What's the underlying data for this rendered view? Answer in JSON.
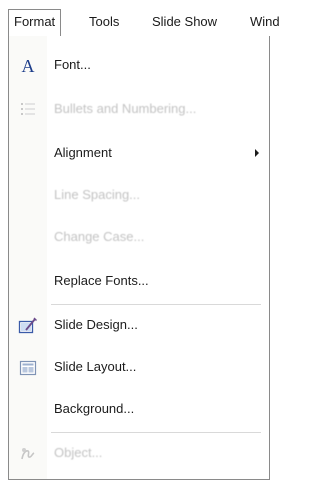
{
  "menubar": {
    "items": [
      "Format",
      "Tools",
      "Slide Show",
      "Wind"
    ]
  },
  "menu": {
    "items": [
      {
        "label": "Font...",
        "enabled": true,
        "icon": "font-a-icon"
      },
      {
        "label": "Bullets and Numbering...",
        "enabled": false,
        "icon": "bullets-icon"
      },
      {
        "label": "Alignment",
        "enabled": true,
        "submenu": true
      },
      {
        "label": "Line Spacing...",
        "enabled": false
      },
      {
        "label": "Change Case...",
        "enabled": false
      },
      {
        "label": "Replace Fonts...",
        "enabled": true
      },
      {
        "label": "Slide Design...",
        "enabled": true,
        "icon": "slide-design-icon"
      },
      {
        "label": "Slide Layout...",
        "enabled": true,
        "icon": "slide-layout-icon"
      },
      {
        "label": "Background...",
        "enabled": true
      },
      {
        "label": "Object...",
        "enabled": false,
        "icon": "object-icon"
      }
    ],
    "font_icon_glyph": "A"
  },
  "colors": {
    "menu_text": "#1c1c1c",
    "disabled_text": "#c3c3c3",
    "icon_blue": "#1d3d8a",
    "border": "#8a8a8a"
  }
}
